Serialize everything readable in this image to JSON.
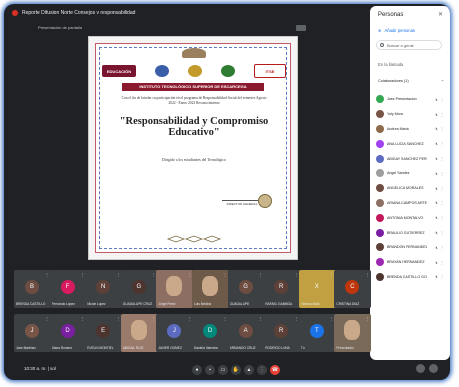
{
  "header": {
    "meeting_title": "Reporte Difusion Norte Consejos v responsabilidad",
    "presenting_label": "Presentación de pantalla"
  },
  "certificate": {
    "logo_education": "EDUCACIÓN",
    "logo_itse": "ITSE",
    "institute": "INSTITUTO TECNOLÓGICO SUPERIOR DE ESCARCEGA",
    "body_text": "Con el fin de brindar su participación en el programa de Responsabilidad Social del semestre Agosto 2022 - Enero 2023 Reconocimiento",
    "recognition_title": "\"Responsabilidad y Compromiso Educativo\"",
    "recipient": "Dirigido a los estudiantes del Tecnológico",
    "signer": "DIRECTOR GENERAL"
  },
  "people_panel": {
    "title": "Personas",
    "close_icon": "close-icon",
    "add_people": "Añadir personas",
    "search_placeholder": "Buscar a gente",
    "in_call_label": "En la llamada",
    "collaborators_label": "Colaboradores (1)",
    "participants": [
      {
        "name": "Jose Presentacion",
        "color": "#34a853"
      },
      {
        "name": "Yoly Mora",
        "color": "#795548"
      },
      {
        "name": "Andrea Maria",
        "color": "#8e6a4a"
      },
      {
        "name": "ANA LUCIA SANCHEZ",
        "color": "#a142f4"
      },
      {
        "name": "ABIGAY SANCHEZ PEREZ",
        "color": "#5c6bc0"
      },
      {
        "name": "Angel Sandez",
        "color": "#9e9e9e"
      },
      {
        "name": "ANGELICA MORALES",
        "color": "#6d4c41"
      },
      {
        "name": "ARIANA CAMPOS ARTEAGA",
        "color": "#8d6e63"
      },
      {
        "name": "ANTONIA MONTALVO",
        "color": "#c2185b"
      },
      {
        "name": "BRAULIO GUTIERREZ",
        "color": "#7b1fa2"
      },
      {
        "name": "BRANDON FERNANDEZ",
        "color": "#5d4037"
      },
      {
        "name": "BRAYAN HERNANDEZ",
        "color": "#9c27b0"
      },
      {
        "name": "BRENDA CASTILLO GOMEZ",
        "color": "#4e342e"
      }
    ]
  },
  "tiles": [
    {
      "name": "BRENDA CASTILLO",
      "initial": "B",
      "color": "#6d4c41",
      "video": false
    },
    {
      "name": "Fernando Lopez",
      "initial": "F",
      "color": "#d81b60",
      "video": false
    },
    {
      "name": "Nicole Lopez",
      "initial": "N",
      "color": "#5d4037",
      "video": false
    },
    {
      "name": "GUADALUPE CRUZ",
      "initial": "G",
      "color": "#4e342e",
      "video": false
    },
    {
      "name": "Jorge Perez",
      "initial": "",
      "color": "#8d6e63",
      "video": true
    },
    {
      "name": "Luis Medina",
      "initial": "",
      "color": "#6d5a48",
      "video": true
    },
    {
      "name": "GUADALUPE",
      "initial": "G",
      "color": "#6d4c41",
      "video": false
    },
    {
      "name": "RAFAEL GAMBOA",
      "initial": "R",
      "color": "#5d4037",
      "video": false
    },
    {
      "name": "Ximena Mata",
      "initial": "X",
      "color": "#c0a040",
      "video": true
    },
    {
      "name": "CRISTINA DIAZ",
      "initial": "C",
      "color": "#bf360c",
      "video": false
    },
    {
      "name": "Jose Martinez",
      "initial": "J",
      "color": "#795548",
      "video": false
    },
    {
      "name": "Diana Romero",
      "initial": "D",
      "color": "#7b1fa2",
      "video": false
    },
    {
      "name": "EVELIN MONTIEL",
      "initial": "E",
      "color": "#4e342e",
      "video": false
    },
    {
      "name": "ABIGAIL RUIZ",
      "initial": "",
      "color": "#9a7a6a",
      "video": true
    },
    {
      "name": "JAVIER GOMEZ",
      "initial": "J",
      "color": "#5c6bc0",
      "video": false
    },
    {
      "name": "Daniela Valencia",
      "initial": "D",
      "color": "#00897b",
      "video": false
    },
    {
      "name": "ARMANDO CRUZ",
      "initial": "A",
      "color": "#6d4c41",
      "video": false
    },
    {
      "name": "RODRIGO LUNA",
      "initial": "R",
      "color": "#5d4037",
      "video": false
    },
    {
      "name": "Tú",
      "initial": "T",
      "color": "#1a73e8",
      "video": false
    },
    {
      "name": "Presentador",
      "initial": "",
      "color": "#7a6a5a",
      "video": true
    }
  ],
  "footer": {
    "meeting_time": "10:30 a. m. | sol",
    "controls": [
      "mic-icon",
      "camera-icon",
      "captions-icon",
      "raise-hand-icon",
      "present-icon",
      "more-icon",
      "end-call-icon"
    ]
  }
}
